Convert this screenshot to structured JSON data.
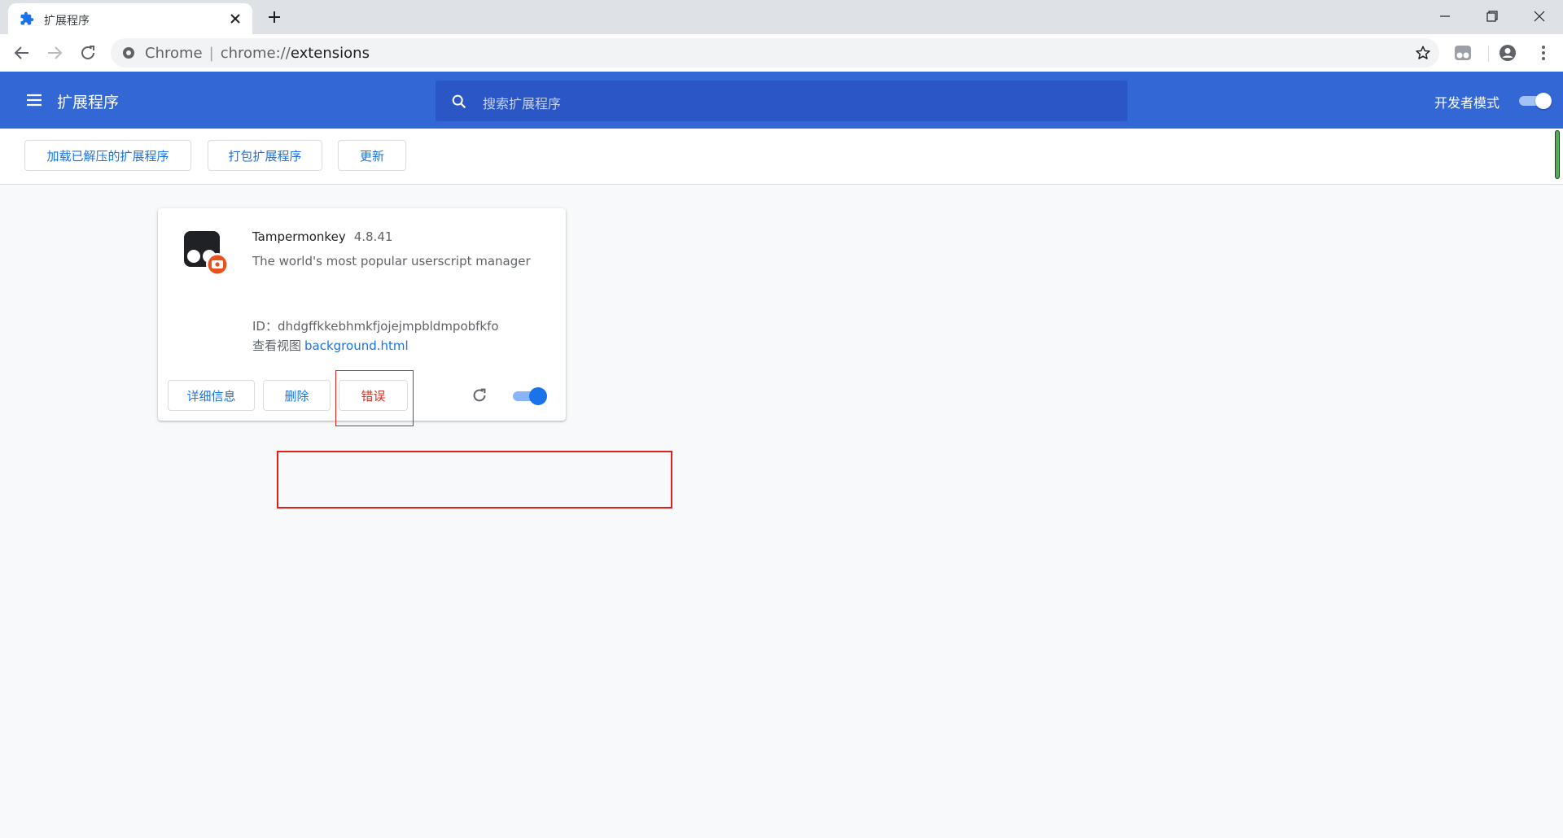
{
  "browser": {
    "tab_title": "扩展程序",
    "omnibox_scheme_label": "Chrome",
    "omnibox_url_prefix": "chrome://",
    "omnibox_url_host": "extensions"
  },
  "header": {
    "title": "扩展程序",
    "search_placeholder": "搜索扩展程序",
    "dev_mode_label": "开发者模式",
    "dev_mode_on": true
  },
  "toolbar": {
    "load_unpacked": "加载已解压的扩展程序",
    "pack": "打包扩展程序",
    "update": "更新"
  },
  "extension": {
    "name": "Tampermonkey",
    "version": "4.8.41",
    "description": "The world's most popular userscript manager",
    "id_label": "ID：",
    "id": "dhdgffkkebhmkfjojejmpbldmpobfkfo",
    "views_label": "查看视图",
    "view_link": "background.html",
    "details_button": "详细信息",
    "remove_button": "删除",
    "errors_button": "错误",
    "enabled": true
  },
  "colors": {
    "header_blue": "#3367d6",
    "search_bg": "#2a56c6",
    "link_blue": "#1a73e8",
    "error_red": "#d93025",
    "annotation_red": "#e0201b"
  }
}
